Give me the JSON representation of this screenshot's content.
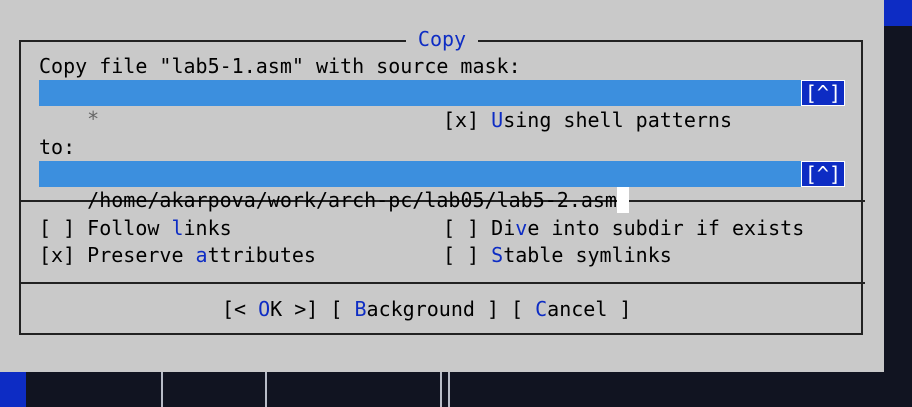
{
  "dialog": {
    "title": "Copy",
    "source_label": "Copy file \"lab5-1.asm\" with source mask:",
    "source_mask": "*",
    "history_button": "[^]",
    "shell_patterns": {
      "box": "[x] ",
      "hot": "U",
      "rest": "sing shell patterns"
    },
    "to_label": "to:",
    "destination": "/home/akarpova/work/arch-pc/lab05/lab5-2.asm",
    "options": {
      "follow_links": {
        "box": "[ ] ",
        "pre": "Follow ",
        "hot": "l",
        "rest": "inks"
      },
      "dive_into_subdir": {
        "box": "[ ] ",
        "pre": "Di",
        "hot": "v",
        "rest": "e into subdir if exists"
      },
      "preserve_attributes": {
        "box": "[x] ",
        "pre": "Preserve ",
        "hot": "a",
        "rest": "ttributes"
      },
      "stable_symlinks": {
        "box": "[ ] ",
        "pre": "",
        "hot": "S",
        "rest": "table symlinks"
      }
    },
    "buttons": {
      "ok": {
        "pre": "[< ",
        "hot": "O",
        "rest": "K >]"
      },
      "background": {
        "pre": "[ ",
        "hot": "B",
        "rest": "ackground ]"
      },
      "cancel": {
        "pre": "[ ",
        "hot": "C",
        "rest": "ancel ]"
      }
    }
  },
  "colors": {
    "dialog_bg": "#c9c9c9",
    "accent": "#0d2cc4",
    "input_bg": "#3c8fde"
  }
}
